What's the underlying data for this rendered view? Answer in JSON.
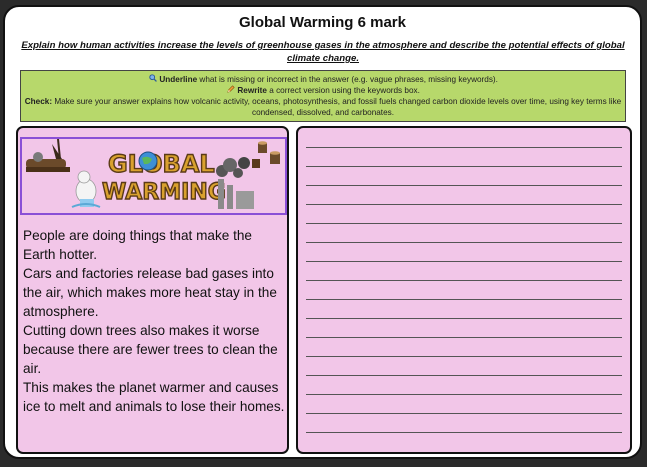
{
  "worksheet": {
    "title": "Global Warming 6 mark",
    "question": "Explain how human activities increase the levels of greenhouse gases in the atmosphere and describe the potential effects of global climate change.",
    "instructions": {
      "underline_icon": "magnifier-icon",
      "underline_label": "Underline",
      "underline_text": " what is missing or incorrect in the answer (e.g. vague phrases, missing keywords).",
      "rewrite_icon": "pencil-icon",
      "rewrite_label": "Rewrite",
      "rewrite_text": " a correct version using the keywords box.",
      "check_label": "Check:",
      "check_text": " Make sure your answer explains how volcanic activity, oceans, photosynthesis, and fossil fuels changed carbon dioxide levels over time, using key terms like condensed, dissolved, and carbonates."
    },
    "banner": {
      "word1": "GLOBAL",
      "word2": "WARMING",
      "colors": {
        "text": "#d9a12e",
        "outline": "#5a3a16",
        "globe": "#3d8fd6",
        "smoke": "#555555"
      }
    },
    "answer_paragraphs": [
      "People are doing things that make the Earth hotter.",
      " Cars and factories release bad gases into the air, which makes more heat stay in the atmosphere.",
      " Cutting down trees also makes it worse because there are fewer trees to clean the air.",
      " This makes the planet warmer and causes ice to melt and animals to lose their homes."
    ],
    "colors": {
      "panel": "#f2c6e8",
      "instructions_bg": "#b7d86b",
      "banner_border": "#8a4fd6"
    }
  }
}
